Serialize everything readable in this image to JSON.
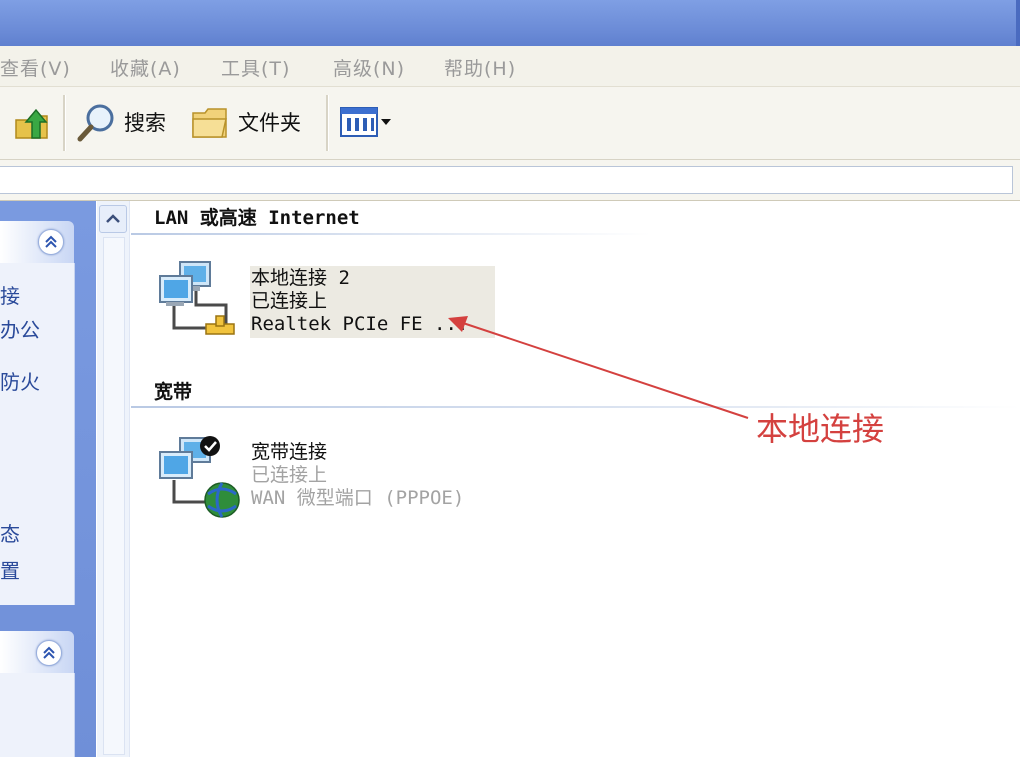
{
  "menu": {
    "items": [
      {
        "label": "查看(V)"
      },
      {
        "label": "收藏(A)"
      },
      {
        "label": "工具(T)"
      },
      {
        "label": "高级(N)"
      },
      {
        "label": "帮助(H)"
      }
    ]
  },
  "toolbar": {
    "up_icon": "up-folder-icon",
    "search_label": "搜索",
    "folders_label": "文件夹",
    "views_icon": "views-icon"
  },
  "left_pane": {
    "tasks_partial": [
      "接",
      "办公",
      "防火",
      "态",
      "置"
    ]
  },
  "groups": {
    "lan_title": "LAN 或高速 Internet",
    "broadband_title": "宽带"
  },
  "connections": {
    "local": {
      "name": "本地连接 2",
      "status": "已连接上",
      "device": "Realtek PCIe FE ..."
    },
    "broadband": {
      "name": "宽带连接",
      "status": "已连接上",
      "device": "WAN 微型端口 (PPPOE)"
    }
  },
  "annotation": {
    "label": "本地连接",
    "color": "#d4413f"
  },
  "colors": {
    "title_bar": "#6a8ad6",
    "task_pane": "#7a9ae0",
    "selection": "#eceae2"
  }
}
